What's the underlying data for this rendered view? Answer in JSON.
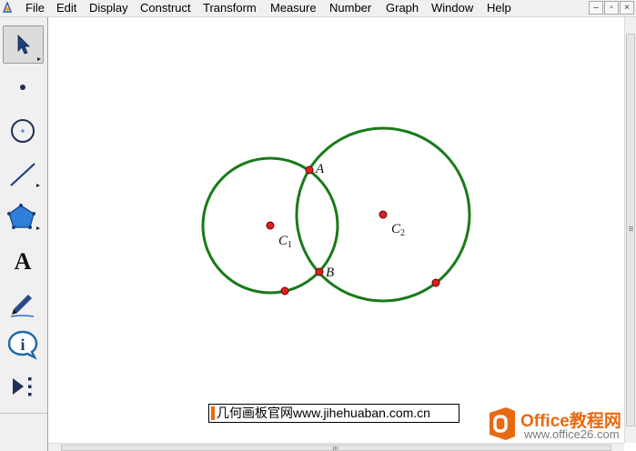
{
  "menu": {
    "items": [
      {
        "id": "file",
        "label": "File"
      },
      {
        "id": "edit",
        "label": "Edit"
      },
      {
        "id": "display",
        "label": "Display"
      },
      {
        "id": "construct",
        "label": "Construct"
      },
      {
        "id": "transform",
        "label": "Transform"
      },
      {
        "id": "measure",
        "label": "Measure"
      },
      {
        "id": "number",
        "label": "Number"
      },
      {
        "id": "graph",
        "label": "Graph"
      },
      {
        "id": "window",
        "label": "Window"
      },
      {
        "id": "help",
        "label": "Help"
      }
    ],
    "window_controls": {
      "minimize": "–",
      "restore": "▫",
      "close": "×"
    }
  },
  "toolbox": {
    "tools": [
      {
        "id": "selection-arrow",
        "icon": "arrow-icon",
        "active": true
      },
      {
        "id": "point",
        "icon": "point-icon",
        "active": false
      },
      {
        "id": "compass",
        "icon": "compass-icon",
        "active": false
      },
      {
        "id": "straightedge",
        "icon": "segment-icon",
        "active": false
      },
      {
        "id": "polygon",
        "icon": "polygon-icon",
        "active": false
      },
      {
        "id": "text",
        "icon": "text-tool-icon",
        "glyph": "A",
        "active": false
      },
      {
        "id": "marker",
        "icon": "marker-pen-icon",
        "active": false
      },
      {
        "id": "information",
        "icon": "info-icon",
        "glyph": "i",
        "active": false
      },
      {
        "id": "custom",
        "icon": "custom-tool-icon",
        "active": false
      }
    ]
  },
  "sketch": {
    "circle_color": "#1a7a1a",
    "point_color": "#e02020",
    "labels": {
      "A": "A",
      "B": "B",
      "C1": "C",
      "C1_sub": "1",
      "C2": "C",
      "C2_sub": "2"
    }
  },
  "watermark": {
    "site_text": "几何画板官网www.jihehuaban.com.cn",
    "office_title": "Office教程网",
    "office_url": "www.office26.com"
  }
}
